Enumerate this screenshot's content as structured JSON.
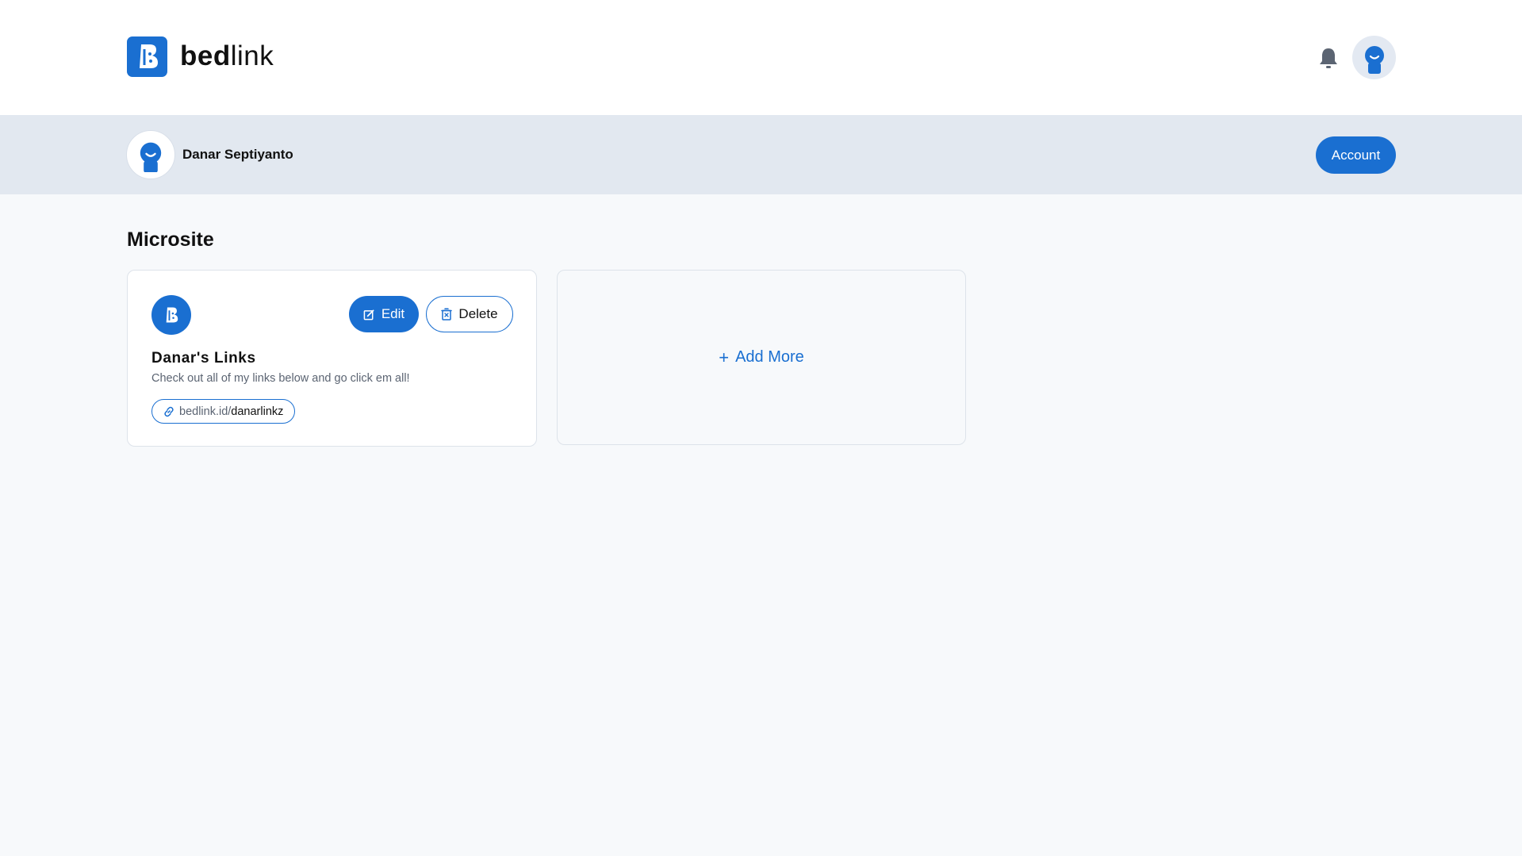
{
  "header": {
    "logo_bold": "bed",
    "logo_light": "link",
    "logo_icon": "bedlink-logo-icon",
    "notification_icon": "bell-icon",
    "avatar_icon": "user-avatar-icon"
  },
  "profile": {
    "name": "Danar Septiyanto",
    "account_label": "Account"
  },
  "main": {
    "section_title": "Microsite",
    "microsites": [
      {
        "title": "Danar's Links",
        "description": "Check out all of my links below and go click em all!",
        "link_domain": "bedlink.id/",
        "link_slug": "danarlinkz",
        "edit_label": "Edit",
        "delete_label": "Delete"
      }
    ],
    "add_more_label": "Add More"
  },
  "colors": {
    "accent": "#1a6fd1",
    "profile_bar_bg": "#e2e8f0",
    "page_bg": "#f7f9fb"
  }
}
